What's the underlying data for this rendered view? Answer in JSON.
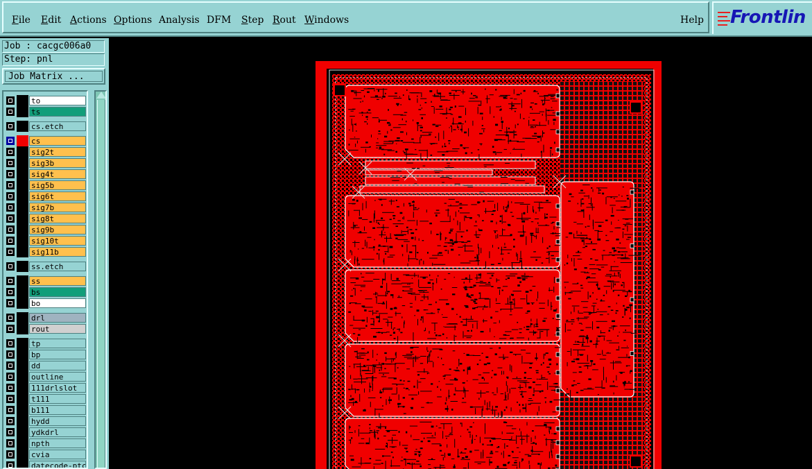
{
  "menubar": {
    "items": [
      "File",
      "Edit",
      "Actions",
      "Options",
      "Analysis",
      "DFM",
      "Step",
      "Rout",
      "Windows"
    ],
    "help": "Help",
    "logo": "Frontlin"
  },
  "info": {
    "job": "Job : cacgc006a0",
    "step": "Step: pnl"
  },
  "job_matrix_label": "Job Matrix ...",
  "layers": [
    {
      "name": "to",
      "color": "#ffffff"
    },
    {
      "name": "ts",
      "color": "#119e7a"
    },
    {
      "name": "cs.etch",
      "color": "#96d3d3"
    },
    {
      "name": "cs",
      "color": "#ffc04d",
      "active": true
    },
    {
      "name": "sig2t",
      "color": "#ffc04d"
    },
    {
      "name": "sig3b",
      "color": "#ffc04d"
    },
    {
      "name": "sig4t",
      "color": "#ffc04d"
    },
    {
      "name": "sig5b",
      "color": "#ffc04d"
    },
    {
      "name": "sig6t",
      "color": "#ffc04d"
    },
    {
      "name": "sig7b",
      "color": "#ffc04d"
    },
    {
      "name": "sig8t",
      "color": "#ffc04d"
    },
    {
      "name": "sig9b",
      "color": "#ffc04d"
    },
    {
      "name": "sig10t",
      "color": "#ffc04d"
    },
    {
      "name": "sig11b",
      "color": "#ffc04d"
    },
    {
      "name": "ss.etch",
      "color": "#96d3d3"
    },
    {
      "name": "ss",
      "color": "#ffc04d"
    },
    {
      "name": "bs",
      "color": "#119e7a"
    },
    {
      "name": "bo",
      "color": "#ffffff"
    },
    {
      "name": "drl",
      "color": "#9fb3c0"
    },
    {
      "name": "rout",
      "color": "#d0d0d0"
    },
    {
      "name": "tp",
      "color": "#96d3d3"
    },
    {
      "name": "bp",
      "color": "#96d3d3"
    },
    {
      "name": "dd",
      "color": "#96d3d3"
    },
    {
      "name": "outline",
      "color": "#96d3d3"
    },
    {
      "name": "111drlslot",
      "color": "#96d3d3"
    },
    {
      "name": "t111",
      "color": "#96d3d3"
    },
    {
      "name": "b111",
      "color": "#96d3d3"
    },
    {
      "name": "hydd",
      "color": "#96d3d3"
    },
    {
      "name": "ydkdrl",
      "color": "#96d3d3"
    },
    {
      "name": "npth",
      "color": "#96d3d3"
    },
    {
      "name": "cvia",
      "color": "#96d3d3"
    },
    {
      "name": "datecode-ptc",
      "color": "#96d3d3"
    }
  ],
  "colors": {
    "copper": "#f00000",
    "background": "#000000",
    "panel": "#96d3d3"
  }
}
